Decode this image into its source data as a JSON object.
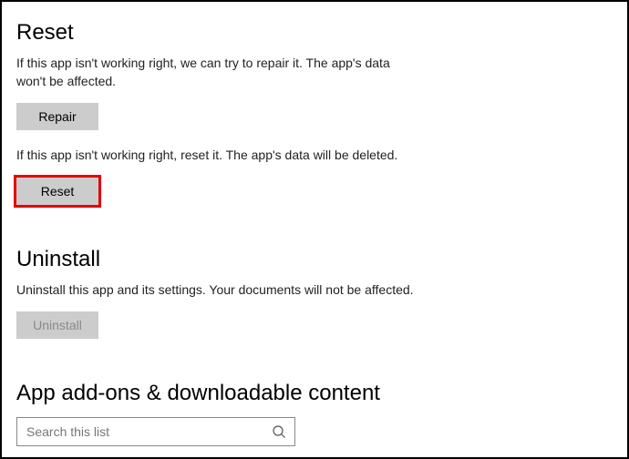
{
  "reset": {
    "heading": "Reset",
    "repair_desc": "If this app isn't working right, we can try to repair it. The app's data won't be affected.",
    "repair_label": "Repair",
    "reset_desc": "If this app isn't working right, reset it. The app's data will be deleted.",
    "reset_label": "Reset"
  },
  "uninstall": {
    "heading": "Uninstall",
    "desc": "Uninstall this app and its settings. Your documents will not be affected.",
    "button_label": "Uninstall"
  },
  "addons": {
    "heading": "App add-ons & downloadable content",
    "search_placeholder": "Search this list"
  }
}
